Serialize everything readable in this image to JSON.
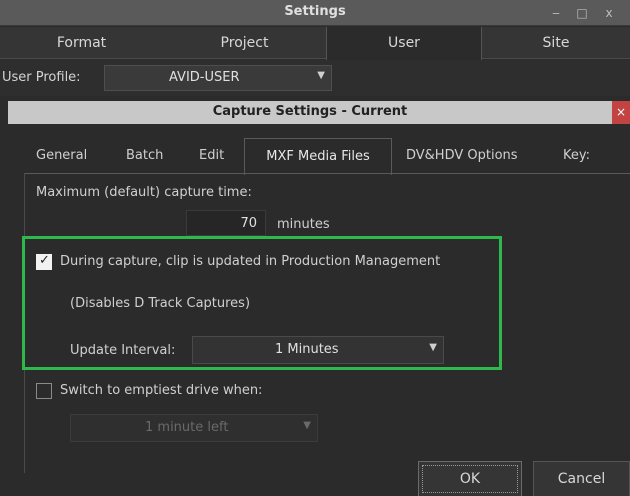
{
  "window": {
    "title": "Settings",
    "controls": {
      "minimize": "‒",
      "maximize": "□",
      "close": "x"
    }
  },
  "outer_tabs": [
    {
      "label": "Format"
    },
    {
      "label": "Project"
    },
    {
      "label": "User",
      "active": true
    },
    {
      "label": "Site"
    }
  ],
  "user_profile": {
    "label": "User Profile:",
    "value": "AVID-USER",
    "arrow": "▼"
  },
  "dialog": {
    "title": "Capture Settings - Current",
    "close": "×",
    "tabs": [
      {
        "label": "General"
      },
      {
        "label": "Batch"
      },
      {
        "label": "Edit"
      },
      {
        "label": "MXF Media Files",
        "active": true
      },
      {
        "label": "DV&HDV Options"
      },
      {
        "label": "Key:"
      }
    ],
    "max_capture": {
      "label": "Maximum (default) capture time:",
      "value": "70",
      "unit": "minutes"
    },
    "production_mgmt": {
      "checkbox_label": "During capture, clip is updated in Production Management",
      "checked": true,
      "note": "(Disables D Track Captures)",
      "interval_label": "Update Interval:",
      "interval_value": "1 Minutes",
      "arrow": "▼"
    },
    "switch_drive": {
      "checkbox_label": "Switch to emptiest drive when:",
      "checked": false,
      "value": "1 minute left",
      "arrow": "▼"
    },
    "buttons": {
      "ok": "OK",
      "cancel": "Cancel"
    }
  },
  "colors": {
    "highlight_box": "#2fb84c",
    "dialog_title_bg": "#c8c8c8",
    "close_red": "#c34242"
  }
}
